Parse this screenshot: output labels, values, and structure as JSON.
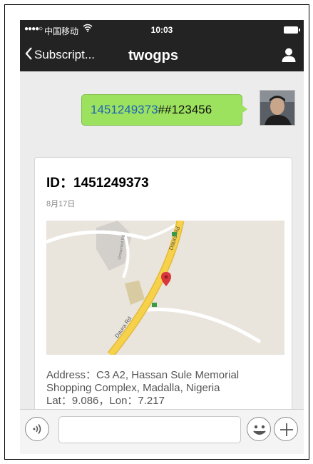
{
  "status_bar": {
    "signal": "●●●●○",
    "carrier": "中国移动",
    "time": "10:03"
  },
  "nav": {
    "back_label": "Subscript...",
    "title": "twogps"
  },
  "message": {
    "link_text": "1451249373",
    "rest_text": "##123456"
  },
  "card": {
    "title": "ID：1451249373",
    "date": "8月17日",
    "map_labels": {
      "road_main": "Daura Rd",
      "road_lower": "Daura Rd",
      "road_small": "Unnamed Rd"
    },
    "address_line1": "Address：C3 A2, Hassan Sule Memorial",
    "address_line2": "Shopping Complex, Madalla, Nigeria",
    "address_line3": "Lat：9.086，Lon：7.217"
  },
  "input": {
    "voice_icon": "voice-icon",
    "emoji_icon": "smiley-icon",
    "plus_icon": "plus-icon",
    "value": ""
  },
  "colors": {
    "bar": "#232323",
    "bubble": "#9ce25e",
    "link": "#1e63b8",
    "background": "#ececec",
    "pin": "#d9363e"
  }
}
